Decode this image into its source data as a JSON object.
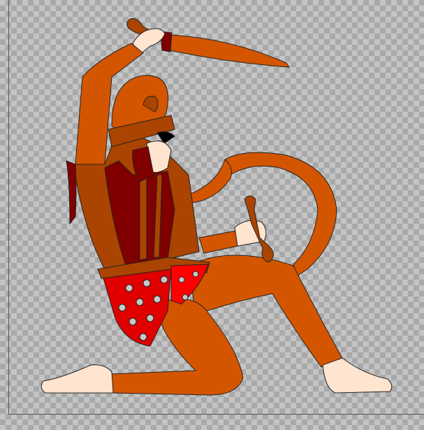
{
  "canvas": {
    "background": "transparent-checkerboard"
  },
  "colors": {
    "skin": "#ffe4d0",
    "orange": "#d45500",
    "dark_orange": "#aa4400",
    "maroon": "#800000",
    "red": "#e00000",
    "bright_red": "#ff0000"
  }
}
